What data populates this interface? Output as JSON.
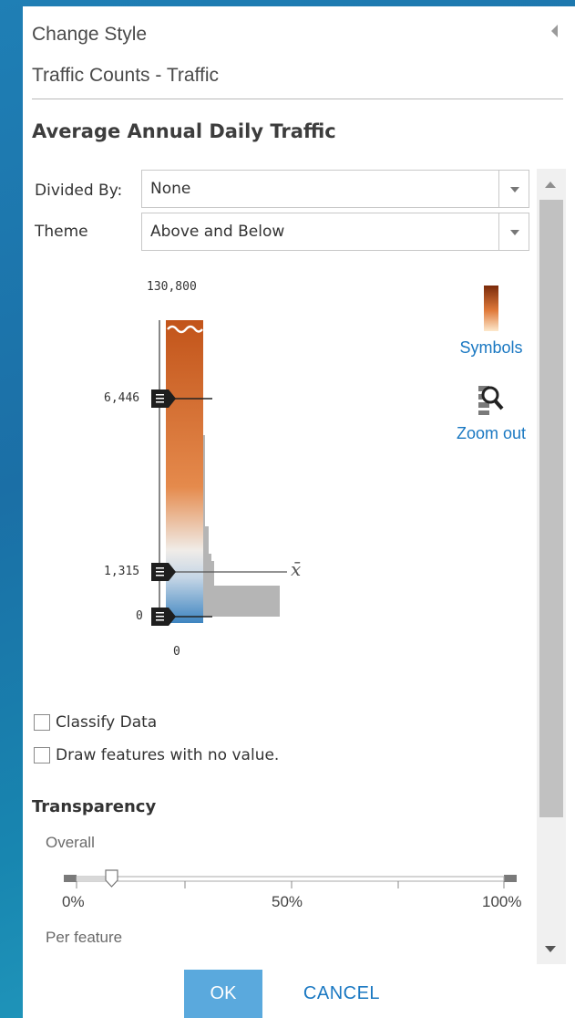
{
  "panel": {
    "title": "Change Style",
    "layer_name": "Traffic Counts - Traffic",
    "attribute_title": "Average Annual Daily Traffic"
  },
  "divided_by": {
    "label": "Divided By:",
    "value": "None"
  },
  "theme": {
    "label": "Theme",
    "value": "Above and Below"
  },
  "histogram": {
    "max_label": "130,800",
    "min_label": "0",
    "handles": [
      {
        "label": "6,446",
        "value": 6446
      },
      {
        "label": "1,315",
        "value": 1315
      },
      {
        "label": "0",
        "value": 0
      }
    ],
    "mean_symbol": "x̄",
    "colors": {
      "high": "#7a2a0a",
      "mid": "#e07a3a",
      "neutral": "#f2f2f2",
      "low": "#3d84c0"
    }
  },
  "side_tools": {
    "symbols_label": "Symbols",
    "zoom_out_label": "Zoom out",
    "icons": [
      "color-ramp-icon",
      "zoom-out-icon"
    ]
  },
  "options": {
    "classify_label": "Classify Data",
    "classify_checked": false,
    "draw_no_value_label": "Draw features with no value.",
    "draw_no_value_checked": false
  },
  "transparency": {
    "title": "Transparency",
    "overall_label": "Overall",
    "overall_value_fraction": 0.08,
    "tick_0": "0%",
    "tick_50": "50%",
    "tick_100": "100%",
    "per_feature_label": "Per feature"
  },
  "buttons": {
    "ok": "OK",
    "cancel": "CANCEL"
  },
  "accent_color": "#1a78c2",
  "ok_color": "#5aa9dd"
}
